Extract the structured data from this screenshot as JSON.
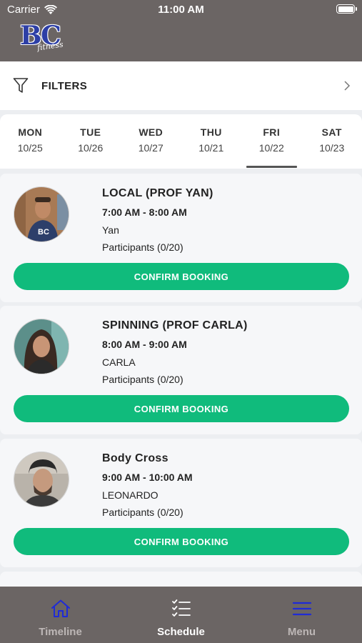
{
  "status_bar": {
    "carrier": "Carrier",
    "time": "11:00 AM"
  },
  "brand": {
    "logo_text": "BC",
    "logo_sub": "fitness",
    "accent_color": "#2d3fa6"
  },
  "filters": {
    "label": "FILTERS"
  },
  "days": [
    {
      "name": "MON",
      "date": "10/25",
      "active": false
    },
    {
      "name": "TUE",
      "date": "10/26",
      "active": false
    },
    {
      "name": "WED",
      "date": "10/27",
      "active": false
    },
    {
      "name": "THU",
      "date": "10/21",
      "active": false
    },
    {
      "name": "FRI",
      "date": "10/22",
      "active": true
    },
    {
      "name": "SAT",
      "date": "10/23",
      "active": false
    }
  ],
  "classes": [
    {
      "title": "LOCAL (PROF YAN)",
      "time": "7:00 AM - 8:00 AM",
      "teacher": "Yan",
      "participants": "Participants (0/20)",
      "button": "CONFIRM BOOKING"
    },
    {
      "title": "SPINNING (PROF CARLA)",
      "time": "8:00 AM - 9:00 AM",
      "teacher": "CARLA",
      "participants": "Participants (0/20)",
      "button": "CONFIRM BOOKING"
    },
    {
      "title": "Body Cross",
      "time": "9:00 AM - 10:00 AM",
      "teacher": "LEONARDO",
      "participants": "Participants (0/20)",
      "button": "CONFIRM BOOKING"
    }
  ],
  "tabbar": {
    "items": [
      {
        "label": "Timeline",
        "icon": "home-icon"
      },
      {
        "label": "Schedule",
        "icon": "checklist-icon"
      },
      {
        "label": "Menu",
        "icon": "hamburger-icon"
      }
    ]
  },
  "colors": {
    "header_bg": "#6b6564",
    "button_green": "#10bb7c",
    "icon_blue": "#1f2bd6"
  }
}
